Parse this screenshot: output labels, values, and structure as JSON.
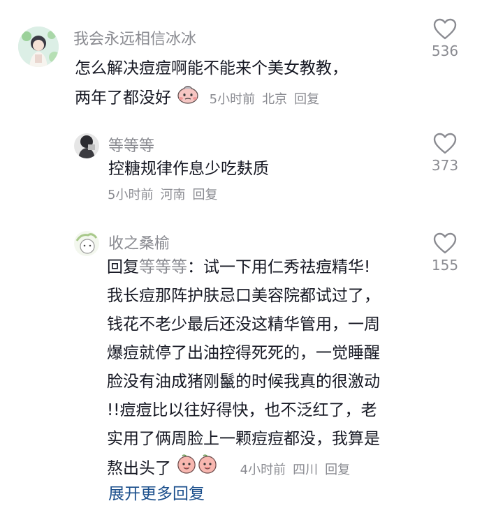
{
  "comments": [
    {
      "username": "我会永远相信冰冰",
      "lines": [
        "怎么解决痘痘啊能不能来个美女教教，",
        "两年了都没好"
      ],
      "time": "5小时前",
      "location": "北京",
      "reply_label": "回复",
      "likes": "536"
    },
    {
      "username": "等等等",
      "lines": [
        "控糖规律作息少吃麸质"
      ],
      "time": "5小时前",
      "location": "河南",
      "reply_label": "回复",
      "likes": "373"
    },
    {
      "username": "收之桑榆",
      "reply_prefix": "回复",
      "reply_to": "等等等",
      "lines": [
        "：试一下用仁秀祛痘精华!",
        "我长痘那阵护肤忌口美容院都试过了，",
        "钱花不老少最后还没这精华管用，一周",
        "爆痘就停了出油控得死死的，一觉睡醒",
        "脸没有油成猪刚鬣的时候我真的很激动",
        "!!痘痘比以往好得快，也不泛红了，老",
        "实用了俩周脸上一颗痘痘都没，我算是",
        "熬出头了"
      ],
      "time": "4小时前",
      "location": "四川",
      "reply_label": "回复",
      "likes": "155"
    }
  ],
  "expand_label": "展开更多回复",
  "icons": {
    "like": "heart-outline-icon",
    "emoji": "peach-face-emoji"
  },
  "colors": {
    "text": "#161823",
    "muted": "#8a8b91",
    "link": "#1b4f8c"
  }
}
